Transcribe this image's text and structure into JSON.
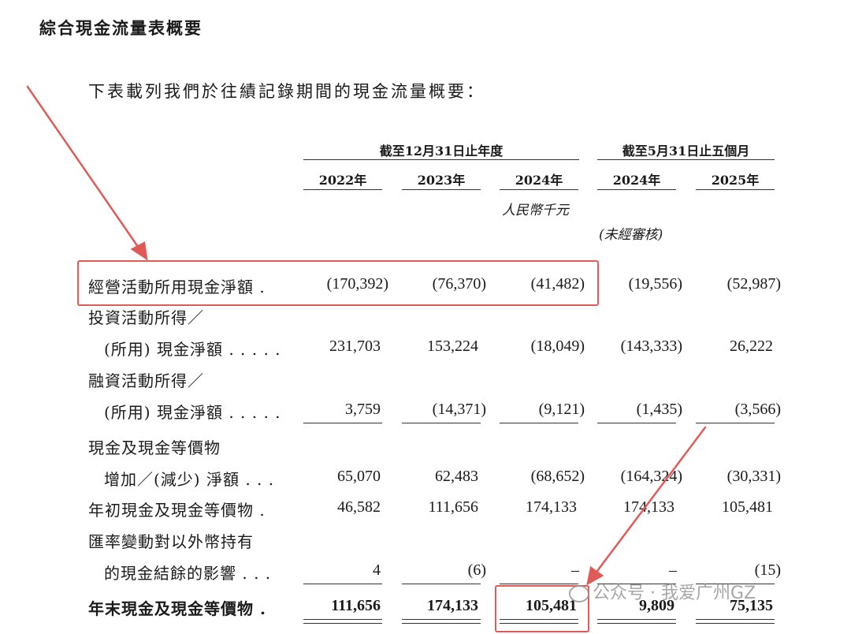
{
  "title": "綜合現金流量表概要",
  "intro": "下表載列我們於往績記錄期間的現金流量概要：",
  "header": {
    "group1": "截至12月31日止年度",
    "group2": "截至5月31日止五個月",
    "years": [
      "2022年",
      "2023年",
      "2024年",
      "2024年",
      "2025年"
    ],
    "unit": "人民幣千元",
    "unaudited": "(未經審核)"
  },
  "rows": [
    {
      "label": "經營活動所用現金淨額 .",
      "values": [
        "(170,392)",
        "(76,370)",
        "(41,482)",
        "(19,556)",
        "(52,987)"
      ]
    },
    {
      "label": "投資活動所得／",
      "label2": "(所用) 現金淨額 . . . . .",
      "values": [
        "231,703",
        "153,224",
        "(18,049)",
        "(143,333)",
        "26,222"
      ]
    },
    {
      "label": "融資活動所得／",
      "label2": "(所用) 現金淨額 . . . . .",
      "values": [
        "3,759",
        "(14,371)",
        "(9,121)",
        "(1,435)",
        "(3,566)"
      ]
    },
    {
      "label": "現金及現金等價物",
      "label2": "增加／(減少) 淨額 . . .",
      "values": [
        "65,070",
        "62,483",
        "(68,652)",
        "(164,324)",
        "(30,331)"
      ]
    },
    {
      "label": "年初現金及現金等價物 .",
      "values": [
        "46,582",
        "111,656",
        "174,133",
        "174,133",
        "105,481"
      ]
    },
    {
      "label": "匯率變動對以外幣持有",
      "label2": "的現金結餘的影響 . . .",
      "values": [
        "4",
        "(6)",
        "–",
        "–",
        "(15)"
      ]
    },
    {
      "label": "年末現金及現金等價物 .",
      "values": [
        "111,656",
        "174,133",
        "105,481",
        "9,809",
        "75,135"
      ]
    }
  ],
  "watermark": "公众号 · 我爱广州GZ",
  "annotation_color": "#e05a57"
}
